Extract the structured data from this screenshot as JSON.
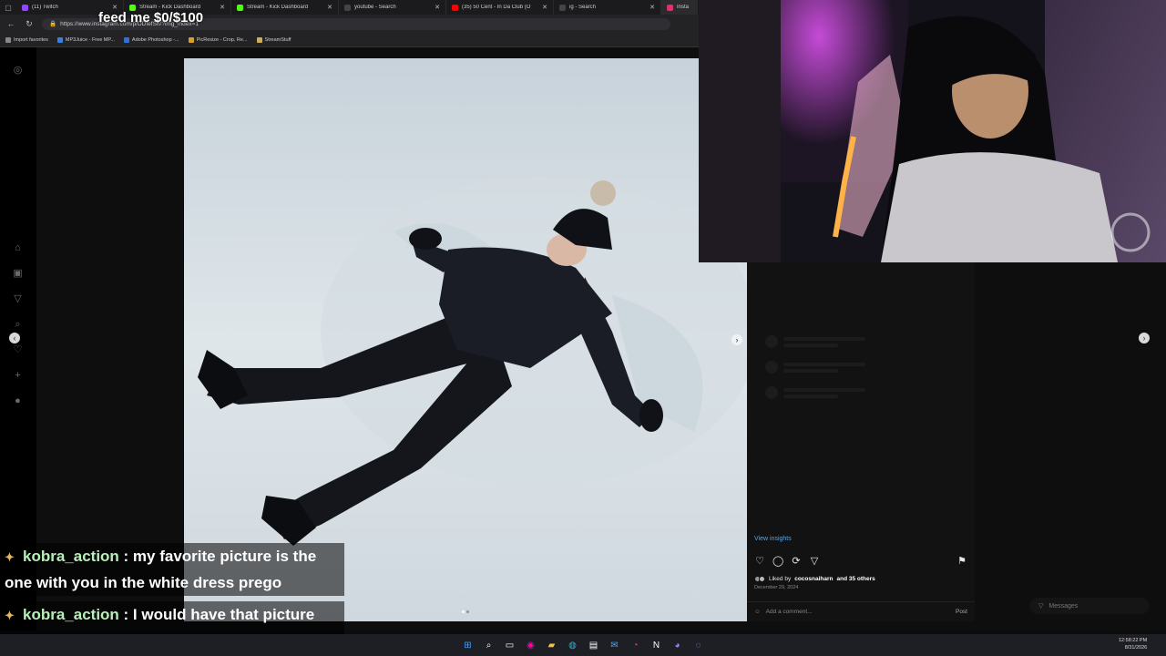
{
  "overlay": {
    "donation_goal": "feed me $0/$100"
  },
  "browser": {
    "tabs": [
      {
        "label": "(11) Twitch",
        "icon": "twitch-icon",
        "color": "#9146ff",
        "active": false
      },
      {
        "label": "Stream - Kick Dashboard",
        "icon": "kick-icon",
        "color": "#53fc18",
        "active": false
      },
      {
        "label": "Stream - Kick Dashboard",
        "icon": "kick-icon",
        "color": "#53fc18",
        "active": false
      },
      {
        "label": "youtube - Search",
        "icon": "search-icon",
        "color": "#888888",
        "active": false
      },
      {
        "label": "(35) 50 Cent - In Da Club (O",
        "icon": "youtube-icon",
        "color": "#ff0000",
        "active": false
      },
      {
        "label": "ig - Search",
        "icon": "search-icon",
        "color": "#888888",
        "active": false
      },
      {
        "label": "Insta",
        "icon": "instagram-icon",
        "color": "#e1306c",
        "active": true
      }
    ],
    "url": "https://www.instagram.com/p/DDfefSn/?img_index=1",
    "bookmarks": [
      "Import favorites",
      "MP3Juice - Free MP...",
      "Adobe Photoshop -...",
      "PicResize - Crop, Re...",
      "StreamStuff"
    ]
  },
  "post": {
    "view_insights": "View insights",
    "liked_prefix": "Liked by",
    "liked_user": "cocosnaiharn",
    "liked_suffix": "and 35 others",
    "date": "December 29, 2024",
    "comment_placeholder": "Add a comment...",
    "post_button": "Post"
  },
  "messages": {
    "label": "Messages"
  },
  "chat": [
    {
      "user": "kobra_action",
      "text": ": my favorite picture is the one with you in the white dress prego"
    },
    {
      "user": "kobra_action",
      "text": ": I would have that picture big af in my house"
    }
  ],
  "clock": {
    "time": "12:58:22 PM",
    "date": "8/31/2026"
  }
}
